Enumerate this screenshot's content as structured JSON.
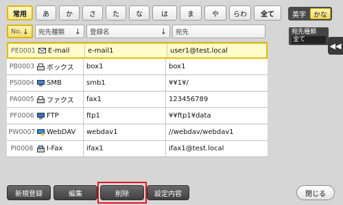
{
  "index_tabs": [
    {
      "label": "常用",
      "active": true
    },
    {
      "label": "あ"
    },
    {
      "label": "か"
    },
    {
      "label": "さ"
    },
    {
      "label": "た"
    },
    {
      "label": "な"
    },
    {
      "label": "は"
    },
    {
      "label": "ま"
    },
    {
      "label": "や"
    },
    {
      "label": "らわ"
    }
  ],
  "all_label": "全て",
  "input_mode": {
    "alpha": "英字",
    "kana": "かな",
    "selected": "かな"
  },
  "columns": {
    "no": "No.",
    "type": "宛先種類",
    "reg_name": "登録名",
    "address": "宛先"
  },
  "rows": [
    {
      "no": "PE0001",
      "icon": "email-icon",
      "type": "E-mail",
      "reg_name": "e-mail1",
      "address": "user1@test.local",
      "selected": true
    },
    {
      "no": "PB0003",
      "icon": "box-icon",
      "type": "ボックス",
      "reg_name": "box1",
      "address": "box1"
    },
    {
      "no": "PS0004",
      "icon": "smb-icon",
      "type": "SMB",
      "reg_name": "smb1",
      "address": "¥¥1¥/"
    },
    {
      "no": "PA0005",
      "icon": "fax-icon",
      "type": "ファクス",
      "reg_name": "fax1",
      "address": "123456789"
    },
    {
      "no": "PF0006",
      "icon": "ftp-icon",
      "type": "FTP",
      "reg_name": "ftp1",
      "address": "¥¥ftp1¥data"
    },
    {
      "no": "PW0007",
      "icon": "webdav-icon",
      "type": "WebDAV",
      "reg_name": "webdav1",
      "address": "//webdav/webdav1"
    },
    {
      "no": "PI0008",
      "icon": "ifax-icon",
      "type": "I-Fax",
      "reg_name": "ifax1",
      "address": "ifax1@test.local"
    }
  ],
  "filter": {
    "label": "宛先種類",
    "value": "全て"
  },
  "buttons": {
    "new": "新規登録",
    "edit": "編集",
    "delete": "削除",
    "settings": "設定内容",
    "close": "閉じる"
  },
  "colors": {
    "highlight": "#e0141c",
    "selected_row": "#fffccc",
    "accent": "#e5bc00"
  }
}
